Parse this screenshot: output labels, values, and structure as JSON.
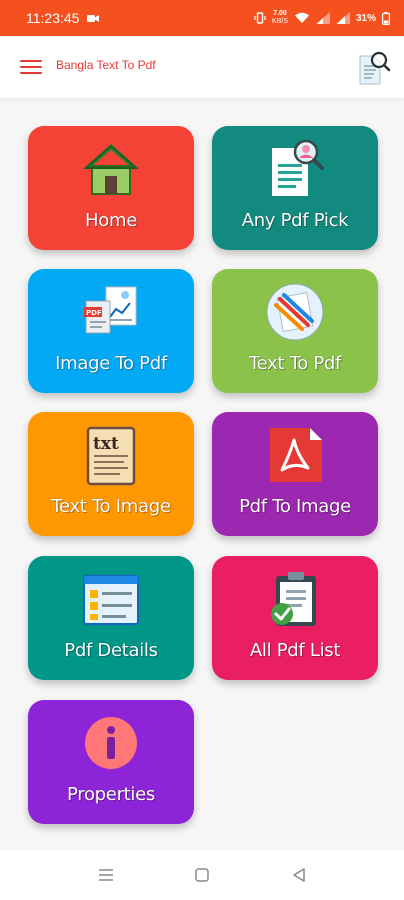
{
  "status_bar": {
    "time": "11:23:45",
    "network_speed_value": "7.00",
    "network_speed_unit": "KB/S",
    "battery": "31%"
  },
  "app_bar": {
    "title": "Bangla Text To Pdf",
    "menu_icon": "hamburger-menu-icon",
    "search_icon": "document-search-icon"
  },
  "tiles": [
    {
      "label": "Home",
      "icon": "house-icon",
      "color": "#f44336"
    },
    {
      "label": "Any Pdf Pick",
      "icon": "document-user-search-icon",
      "color": "#138a80"
    },
    {
      "label": "Image To Pdf",
      "icon": "image-to-pdf-icon",
      "color": "#03a9f4"
    },
    {
      "label": "Text To Pdf",
      "icon": "pencils-icon",
      "color": "#8bc34a"
    },
    {
      "label": "Text To Image",
      "icon": "txt-note-icon",
      "color": "#ff9800"
    },
    {
      "label": "Pdf To Image",
      "icon": "pdf-file-icon",
      "color": "#9c27b0"
    },
    {
      "label": "Pdf Details",
      "icon": "details-window-icon",
      "color": "#009688"
    },
    {
      "label": "All Pdf List",
      "icon": "clipboard-check-icon",
      "color": "#e91e63"
    },
    {
      "label": "Properties",
      "icon": "info-icon",
      "color": "#8e24d8"
    }
  ],
  "colors": {
    "accent": "#f4511e",
    "title": "#e53935",
    "background": "#f6f6f6"
  },
  "nav_bar": {
    "menu_icon": "recent-apps-icon",
    "home_icon": "home-square-icon",
    "back_icon": "back-triangle-icon"
  }
}
